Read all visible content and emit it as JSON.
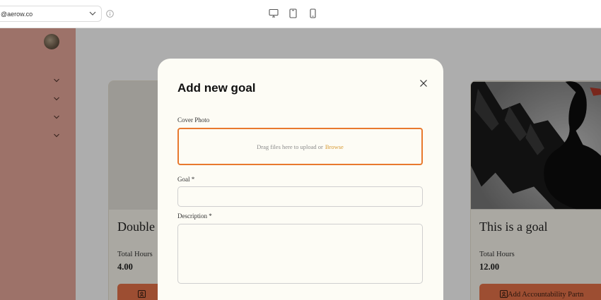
{
  "topbar": {
    "account": "@aerow.co",
    "icons": [
      "chevron-down-icon",
      "info-icon",
      "desktop-icon",
      "tablet-icon",
      "mobile-icon"
    ]
  },
  "cards": [
    {
      "title": "Double",
      "hours_label": "Total Hours",
      "hours_value": "4.00",
      "button_label": ""
    },
    {
      "title": "This is a goal",
      "hours_label": "Total Hours",
      "hours_value": "12.00",
      "button_label": "Add Accountability Partn"
    }
  ],
  "modal": {
    "title": "Add new goal",
    "cover_label": "Cover Photo",
    "dropzone_text": "Drag files here to upload or",
    "browse_label": "Browse",
    "goal_label": "Goal *",
    "goal_value": "",
    "description_label": "Description *",
    "description_value": ""
  },
  "colors": {
    "sidebar": "#e8a99b",
    "accent": "#e8792e",
    "button": "#e8734a",
    "link": "#d89a33",
    "modal_bg": "#fdfcf5"
  }
}
